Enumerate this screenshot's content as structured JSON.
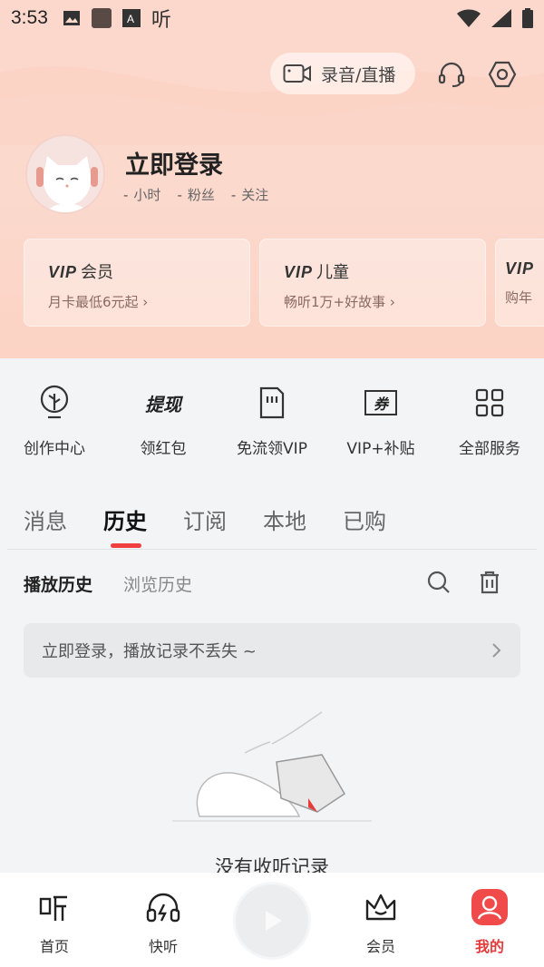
{
  "status_bar": {
    "time": "3:53",
    "app_glyph": "听"
  },
  "header": {
    "record_live_label": "录音/直播"
  },
  "profile": {
    "login_title": "立即登录",
    "stats": [
      {
        "value": "-",
        "label": "小时"
      },
      {
        "value": "-",
        "label": "粉丝"
      },
      {
        "value": "-",
        "label": "关注"
      }
    ]
  },
  "vip_cards": [
    {
      "badge": "VIP",
      "title": "会员",
      "subtitle": "月卡最低6元起 ›"
    },
    {
      "badge": "VIP",
      "title": "儿童",
      "subtitle": "畅听1万+好故事 ›"
    },
    {
      "badge": "VIP",
      "title": "",
      "subtitle": "购年"
    }
  ],
  "actions": [
    {
      "label": "创作中心",
      "icon": "creator-bulb-icon"
    },
    {
      "label": "领红包",
      "icon": "cash-withdraw-icon",
      "icon_text": "提现"
    },
    {
      "label": "免流领VIP",
      "icon": "sim-card-icon"
    },
    {
      "label": "VIP+补贴",
      "icon": "coupon-icon",
      "icon_text": "券"
    },
    {
      "label": "全部服务",
      "icon": "grid-icon"
    }
  ],
  "tabs": [
    "消息",
    "历史",
    "订阅",
    "本地",
    "已购"
  ],
  "active_tab": "历史",
  "subtabs": [
    "播放历史",
    "浏览历史"
  ],
  "login_banner": "立即登录，播放记录不丢失 ~",
  "empty_text": "没有收听记录",
  "bottom_nav": [
    {
      "label": "首页",
      "icon": "home-ting-icon"
    },
    {
      "label": "快听",
      "icon": "headphones-icon"
    },
    {
      "label": "",
      "icon": "play-icon"
    },
    {
      "label": "会员",
      "icon": "crown-icon"
    },
    {
      "label": "我的",
      "icon": "user-icon"
    }
  ],
  "colors": {
    "accent": "#e63b3b",
    "header_bg": "#fbd9cd",
    "page_bg": "#f3f4f6"
  }
}
